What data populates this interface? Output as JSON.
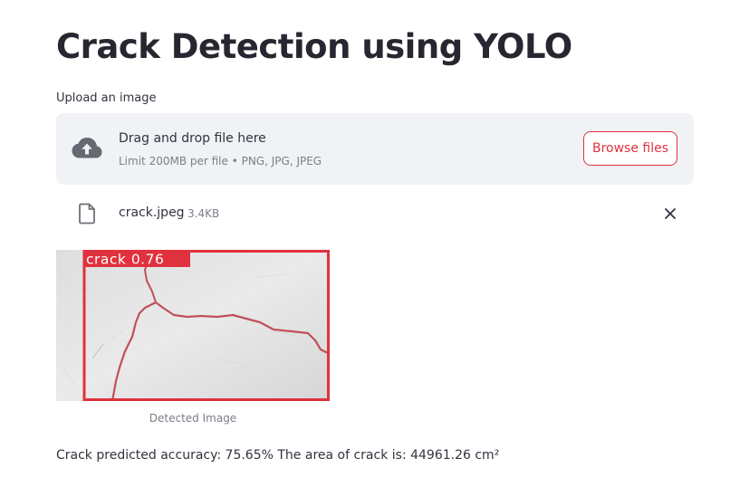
{
  "page": {
    "title": "Crack Detection using YOLO"
  },
  "uploader": {
    "label": "Upload an image",
    "drop_text": "Drag and drop file here",
    "limit_text": "Limit 200MB per file • PNG, JPG, JPEG",
    "browse_label": "Browse files",
    "icon": "cloud-upload-icon"
  },
  "uploaded_file": {
    "name": "crack.jpeg",
    "size": "3.4KB",
    "icon": "file-icon",
    "remove_icon": "close-icon"
  },
  "detection": {
    "box_label": "crack 0.76",
    "caption": "Detected Image"
  },
  "result": {
    "text": "Crack predicted accuracy: 75.65% The area of crack is: 44961.26 cm²"
  },
  "colors": {
    "accent": "#e0313e",
    "dropzone_bg": "#f0f2f6",
    "text": "#31333f",
    "muted": "#7c7e87"
  }
}
